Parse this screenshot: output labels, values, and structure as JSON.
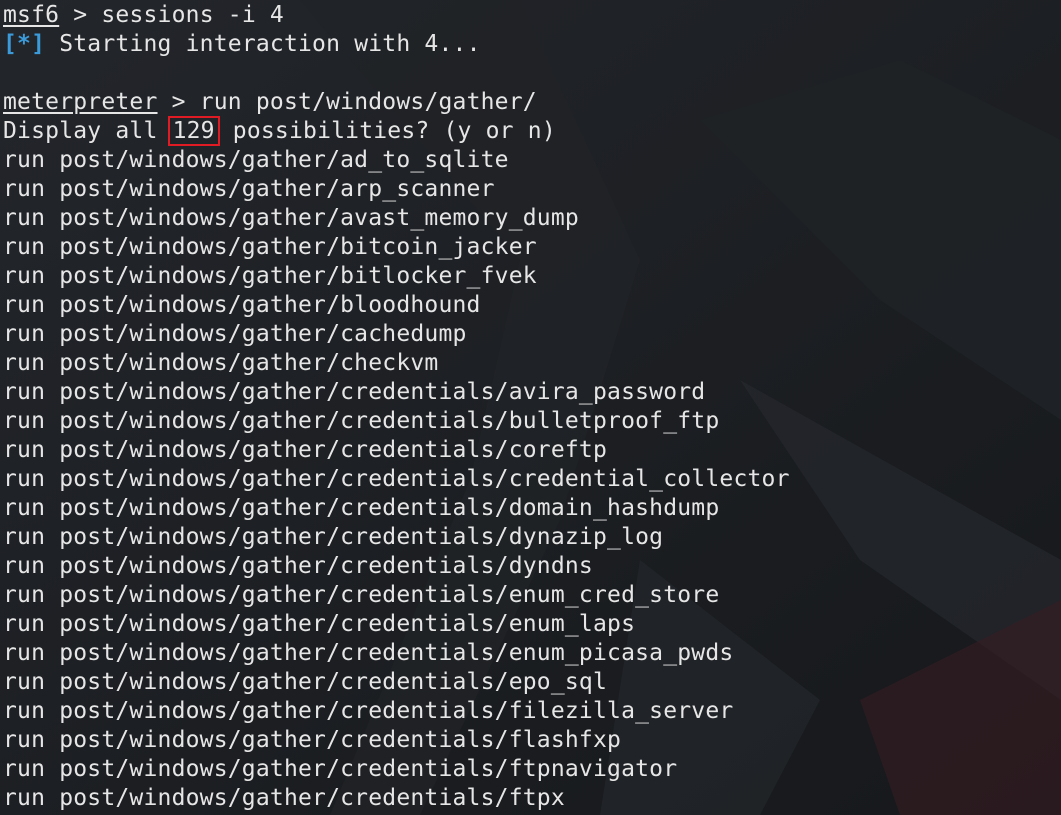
{
  "session_cmd": {
    "prompt": "msf6",
    "separator": " > ",
    "command": "sessions -i 4"
  },
  "status_line": {
    "marker": "[*]",
    "text": " Starting interaction with 4..."
  },
  "run_cmd": {
    "prompt": "meterpreter",
    "separator": " > ",
    "command": "run post/windows/gather/"
  },
  "display_line": {
    "before": "Display all ",
    "count": "129",
    "after": " possibilities? (y or n)"
  },
  "results": [
    "run post/windows/gather/ad_to_sqlite",
    "run post/windows/gather/arp_scanner",
    "run post/windows/gather/avast_memory_dump",
    "run post/windows/gather/bitcoin_jacker",
    "run post/windows/gather/bitlocker_fvek",
    "run post/windows/gather/bloodhound",
    "run post/windows/gather/cachedump",
    "run post/windows/gather/checkvm",
    "run post/windows/gather/credentials/avira_password",
    "run post/windows/gather/credentials/bulletproof_ftp",
    "run post/windows/gather/credentials/coreftp",
    "run post/windows/gather/credentials/credential_collector",
    "run post/windows/gather/credentials/domain_hashdump",
    "run post/windows/gather/credentials/dynazip_log",
    "run post/windows/gather/credentials/dyndns",
    "run post/windows/gather/credentials/enum_cred_store",
    "run post/windows/gather/credentials/enum_laps",
    "run post/windows/gather/credentials/enum_picasa_pwds",
    "run post/windows/gather/credentials/epo_sql",
    "run post/windows/gather/credentials/filezilla_server",
    "run post/windows/gather/credentials/flashfxp",
    "run post/windows/gather/credentials/ftpnavigator",
    "run post/windows/gather/credentials/ftpx"
  ],
  "colors": {
    "background": "#1b1d21",
    "text": "#e6e6e6",
    "info_marker": "#3b9ad9",
    "highlight_box": "#e01b24"
  }
}
